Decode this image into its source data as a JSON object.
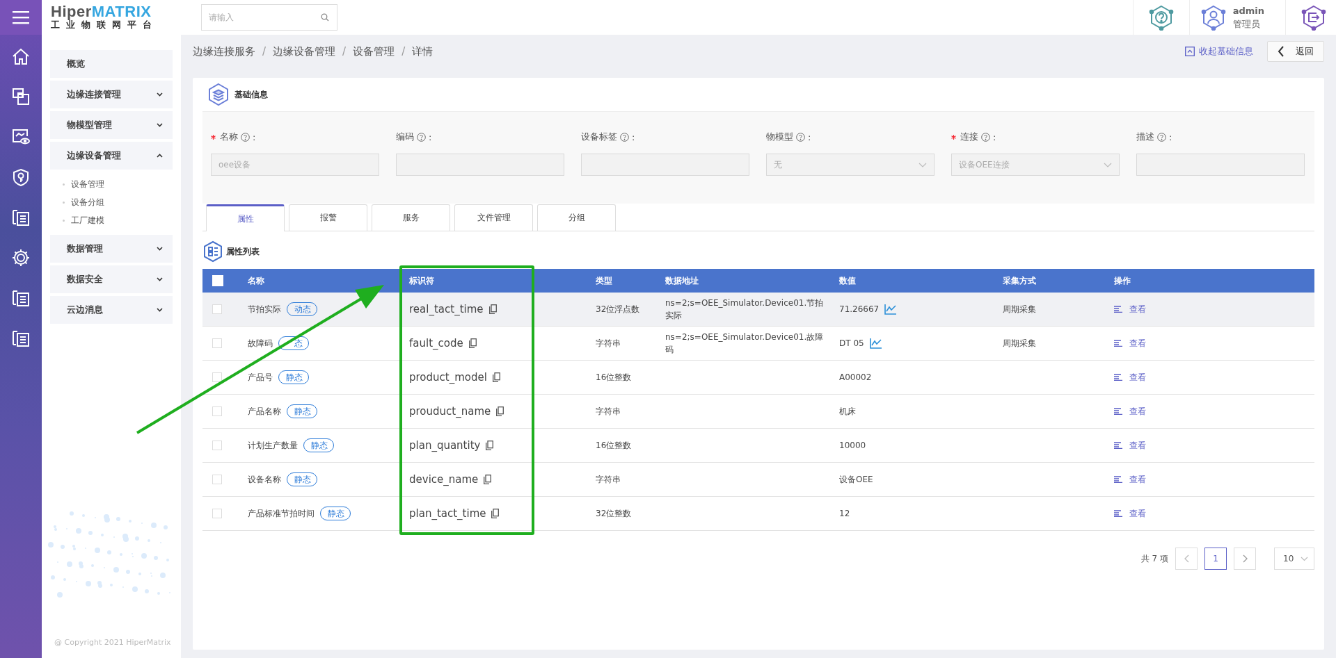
{
  "logo": {
    "part1": "Hiper",
    "part2": "MATRIX",
    "subtitle": "工业物联网平台"
  },
  "search": {
    "placeholder": "请输入"
  },
  "user": {
    "name": "admin",
    "role": "管理员"
  },
  "sidebar": {
    "items": [
      {
        "label": "概览",
        "kind": "link"
      },
      {
        "label": "边缘连接管理",
        "kind": "group",
        "expanded": false
      },
      {
        "label": "物模型管理",
        "kind": "group",
        "expanded": false
      },
      {
        "label": "边缘设备管理",
        "kind": "group",
        "expanded": true,
        "children": [
          {
            "label": "设备管理"
          },
          {
            "label": "设备分组"
          },
          {
            "label": "工厂建模"
          }
        ]
      },
      {
        "label": "数据管理",
        "kind": "group",
        "expanded": false
      },
      {
        "label": "数据安全",
        "kind": "group",
        "expanded": false
      },
      {
        "label": "云边消息",
        "kind": "group",
        "expanded": false
      }
    ],
    "copyright": "@ Copyright 2021 HiperMatrix"
  },
  "breadcrumb": {
    "separator": "/",
    "items": [
      "边缘连接服务",
      "边缘设备管理",
      "设备管理",
      "详情"
    ]
  },
  "collapse_link": "收起基础信息",
  "back_button": "返回",
  "basic_info": {
    "title": "基础信息",
    "label_suffix": ":",
    "fields": [
      {
        "label": "名称",
        "required": true,
        "kind": "input",
        "value": "oee设备"
      },
      {
        "label": "编码",
        "required": false,
        "kind": "input"
      },
      {
        "label": "设备标签",
        "required": false,
        "kind": "input"
      },
      {
        "label": "物模型",
        "required": false,
        "kind": "select",
        "value": "无"
      },
      {
        "label": "连接",
        "required": true,
        "kind": "select",
        "value": "设备OEE连接"
      },
      {
        "label": "描述",
        "required": false,
        "kind": "input"
      }
    ]
  },
  "tabs": [
    {
      "label": "属性",
      "selected": true
    },
    {
      "label": "报警",
      "selected": false
    },
    {
      "label": "服务",
      "selected": false
    },
    {
      "label": "文件管理",
      "selected": false
    },
    {
      "label": "分组",
      "selected": false
    }
  ],
  "properties": {
    "title": "属性列表",
    "select_all_checked": false,
    "columns": [
      "名称",
      "标识符",
      "类型",
      "数据地址",
      "数值",
      "采集方式",
      "操作"
    ],
    "rows": [
      {
        "checked": false,
        "highlighted": true,
        "name": "节拍实际",
        "tag": "动态",
        "identifier": "real_tact_time",
        "type": "32位浮点数",
        "address": "ns=2;s=OEE_Simulator.Device01.节拍实际",
        "value": "71.26667",
        "trend": true,
        "method": "周期采集",
        "action": "查看"
      },
      {
        "checked": false,
        "highlighted": false,
        "name": "故障码",
        "tag": "态",
        "identifier": "fault_code",
        "type": "字符串",
        "address": "ns=2;s=OEE_Simulator.Device01.故障码",
        "value": "DT 05",
        "trend": true,
        "method": "周期采集",
        "action": "查看"
      },
      {
        "checked": false,
        "highlighted": false,
        "name": "产品号",
        "tag": "静态",
        "identifier": "product_model",
        "type": "16位整数",
        "value": "A00002",
        "trend": false,
        "action": "查看"
      },
      {
        "checked": false,
        "highlighted": false,
        "name": "产品名称",
        "tag": "静态",
        "identifier": "prouduct_name",
        "type": "字符串",
        "value": "机床",
        "trend": false,
        "action": "查看"
      },
      {
        "checked": false,
        "highlighted": false,
        "name": "计划生产数量",
        "tag": "静态",
        "identifier": "plan_quantity",
        "type": "16位整数",
        "value": "10000",
        "trend": false,
        "action": "查看"
      },
      {
        "checked": false,
        "highlighted": false,
        "name": "设备名称",
        "tag": "静态",
        "identifier": "device_name",
        "type": "字符串",
        "value": "设备OEE",
        "trend": false,
        "action": "查看"
      },
      {
        "checked": false,
        "highlighted": false,
        "name": "产品标准节拍时间",
        "tag": "静态",
        "identifier": "plan_tact_time",
        "type": "32位整数",
        "value": "12",
        "trend": false,
        "action": "查看"
      }
    ]
  },
  "pagination": {
    "total": "共 7 项",
    "pages": [
      {
        "label": "1",
        "selected": true
      }
    ],
    "page_size": "10"
  }
}
